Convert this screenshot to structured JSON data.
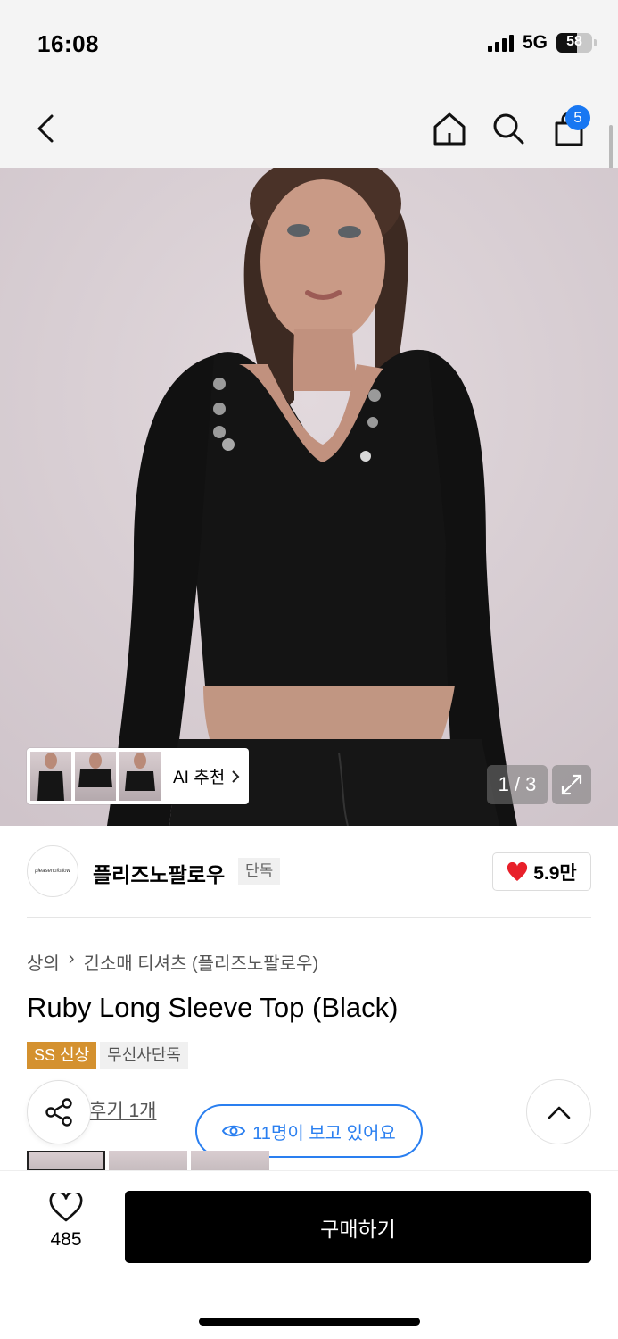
{
  "status_bar": {
    "time": "16:08",
    "network": "5G",
    "battery": "58",
    "battery_level": 0.58
  },
  "header": {
    "back_icon": "chevron-left-icon",
    "home_icon": "home-icon",
    "search_icon": "search-icon",
    "cart_icon": "shopping-bag-icon",
    "cart_count": "5"
  },
  "gallery": {
    "ai_label": "AI 추천",
    "counter": "1 / 3",
    "expand_icon": "expand-icon"
  },
  "brand": {
    "logo_text": "pleasenofollow",
    "name": "플리즈노팔로우",
    "tag": "단독",
    "likes": "5.9만"
  },
  "product": {
    "breadcrumb": [
      "상의",
      "긴소매 티셔츠 (플리즈노팔로우)"
    ],
    "title": "Ruby Long Sleeve Top (Black)",
    "badge_new": "SS 신상",
    "badge_exclusive": "무신사단독",
    "review_link": "후기 1개"
  },
  "floating": {
    "viewers": "11명이 보고 있어요"
  },
  "bottom": {
    "wish_count": "485",
    "buy_label": "구매하기"
  },
  "colors": {
    "accent_blue": "#2a7ff0",
    "badge_gold": "#d4912f",
    "heart_red": "#e8202a",
    "buy_button": "#000000"
  }
}
